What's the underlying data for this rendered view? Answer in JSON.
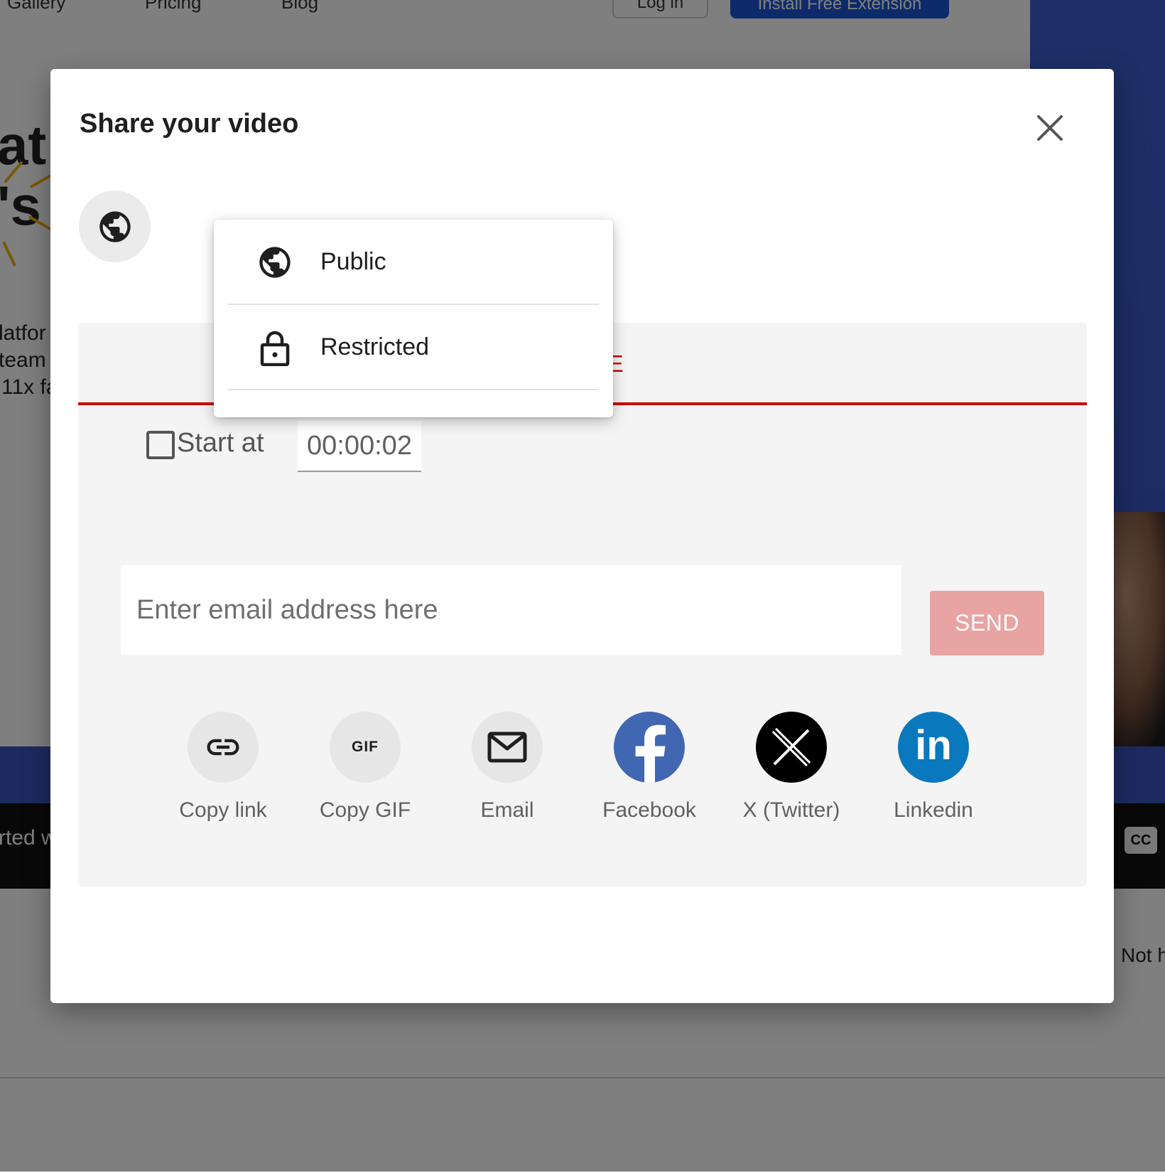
{
  "background": {
    "nav_links": [
      "Gallery",
      "Pricing",
      "Blog"
    ],
    "login_label": "Log in",
    "install_label": "Install Free Extension",
    "headline_fragments": [
      "at",
      "'s"
    ],
    "body_fragments": [
      "latfor",
      "team",
      "11x fa"
    ],
    "player_caption_fragment": "rted w",
    "cc_label": "CC",
    "right_fragment": "Not h"
  },
  "modal": {
    "title": "Share your video",
    "close_icon": "close-icon",
    "visibility_icon": "globe-icon",
    "tab_label": "SHARE",
    "start_at_label": "Start at",
    "start_at_checked": false,
    "start_time": "00:00:02",
    "email_placeholder": "Enter email address here",
    "email_value": "",
    "send_label": "SEND",
    "share_targets": [
      {
        "label": "Copy link",
        "icon": "link-icon"
      },
      {
        "label": "Copy GIF",
        "icon": "gif-icon",
        "icon_text": "GIF"
      },
      {
        "label": "Email",
        "icon": "envelope-icon"
      },
      {
        "label": "Facebook",
        "icon": "facebook-icon"
      },
      {
        "label": "X (Twitter)",
        "icon": "x-twitter-icon"
      },
      {
        "label": "Linkedin",
        "icon": "linkedin-icon",
        "icon_text": "in"
      }
    ]
  },
  "visibility_menu": {
    "options": [
      {
        "label": "Public",
        "icon": "globe-icon"
      },
      {
        "label": "Restricted",
        "icon": "lock-icon"
      }
    ]
  },
  "colors": {
    "accent": "#cc0000",
    "send_disabled": "#e8a3a3",
    "panel_bg": "#f4f4f4",
    "facebook": "#4267b2",
    "linkedin": "#0a78bd",
    "x_twitter": "#000000",
    "icon_circle": "#e6e6e6",
    "install_button": "#1a56d6"
  }
}
